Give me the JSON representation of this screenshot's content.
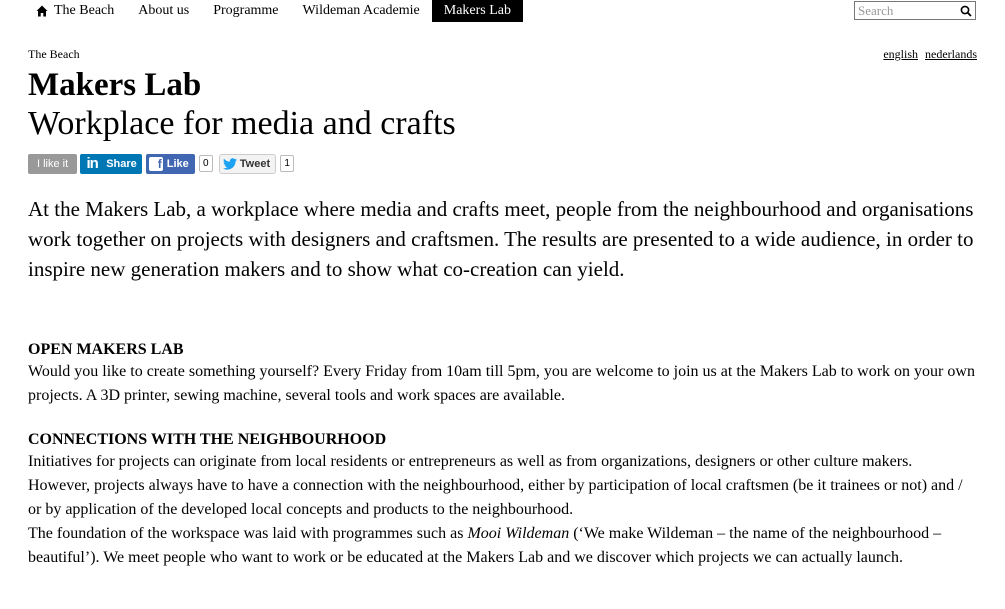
{
  "nav": {
    "items": [
      {
        "label": "The Beach"
      },
      {
        "label": "About us"
      },
      {
        "label": "Programme"
      },
      {
        "label": "Wildeman Academie"
      },
      {
        "label": "Makers Lab"
      }
    ],
    "active_index": 4,
    "search": {
      "placeholder": "Search",
      "value": ""
    }
  },
  "breadcrumb": "The Beach",
  "languages": {
    "english": "english",
    "nederlands": "nederlands"
  },
  "page": {
    "title": "Makers Lab",
    "subtitle": "Workplace for media and crafts"
  },
  "social": {
    "ilike": "I like it",
    "linkedin": "Share",
    "facebook": "Like",
    "facebook_count": "0",
    "twitter": "Tweet",
    "twitter_count": "1",
    "colors": {
      "linkedin": "#0077b5",
      "facebook": "#4267b2",
      "ilike": "#999999"
    }
  },
  "intro": "At the Makers Lab, a workplace where media and crafts meet, people from the neighbourhood and organisations work together on projects with designers and craftsmen. The results are presented to a wide audience, in order to inspire new generation makers and to show what co-creation can yield.",
  "sections": [
    {
      "heading": "OPEN MAKERS LAB",
      "text": "Would you like to create something yourself? Every Friday from 10am till 5pm, you are welcome to join us at the Makers Lab to work on your own projects. A 3D printer, sewing machine, several tools and work spaces are available."
    },
    {
      "heading": "CONNECTIONS WITH THE NEIGHBOURHOOD",
      "text": "Initiatives for projects can originate from local residents or entrepreneurs as well as from organizations, designers or other culture makers. However, projects always have to have a connection with the neighbourhood, either by participation of local craftsmen (be it trainees or not) and / or by application of the developed local concepts and products to the neighbourhood.",
      "text2_before": "The foundation of the workspace was laid with programmes such as ",
      "text2_em": "Mooi Wildeman",
      "text2_after": " (‘We make Wildeman – the name of the neighbourhood – beautiful’). We meet people who want to work or be educated at the Makers Lab and we discover which projects we can actually launch."
    }
  ]
}
